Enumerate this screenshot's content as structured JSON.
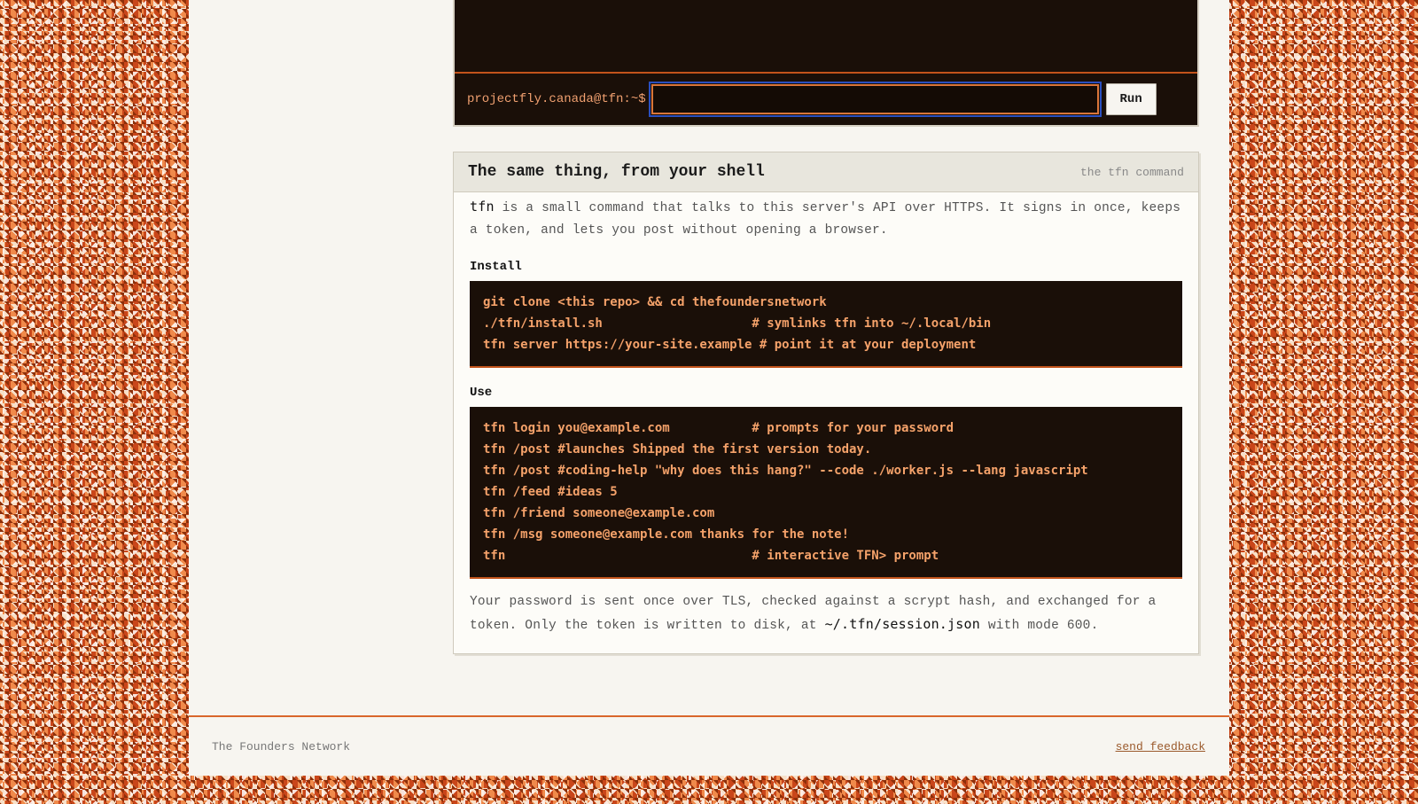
{
  "terminal": {
    "prompt": "projectfly.canada@tfn:~$",
    "input_value": "",
    "run_label": "Run"
  },
  "card": {
    "title": "The same thing, from your shell",
    "tag": "the tfn command",
    "intro_cmd": "tfn",
    "intro_text": " is a small command that talks to this server's API over HTTPS. It signs in once, keeps a token, and lets you post without opening a browser.",
    "install_heading": "Install",
    "install_lines": [
      "git clone <this repo> && cd thefoundersnetwork",
      "./tfn/install.sh                    # symlinks tfn into ~/.local/bin",
      "tfn server https://your-site.example # point it at your deployment"
    ],
    "use_heading": "Use",
    "use_lines": [
      "tfn login you@example.com           # prompts for your password",
      "tfn /post #launches Shipped the first version today.",
      "tfn /post #coding-help \"why does this hang?\" --code ./worker.js --lang javascript",
      "tfn /feed #ideas 5",
      "tfn /friend someone@example.com",
      "tfn /msg someone@example.com thanks for the note!",
      "tfn                                 # interactive TFN> prompt"
    ],
    "footnote_before": "Your password is sent once over TLS, checked against a scrypt hash, and exchanged for a token. Only the token is written to disk, at ",
    "footnote_path": "~/.tfn/session.json",
    "footnote_after": " with mode 600."
  },
  "footer": {
    "brand": "The Founders Network",
    "feedback": "send feedback"
  }
}
